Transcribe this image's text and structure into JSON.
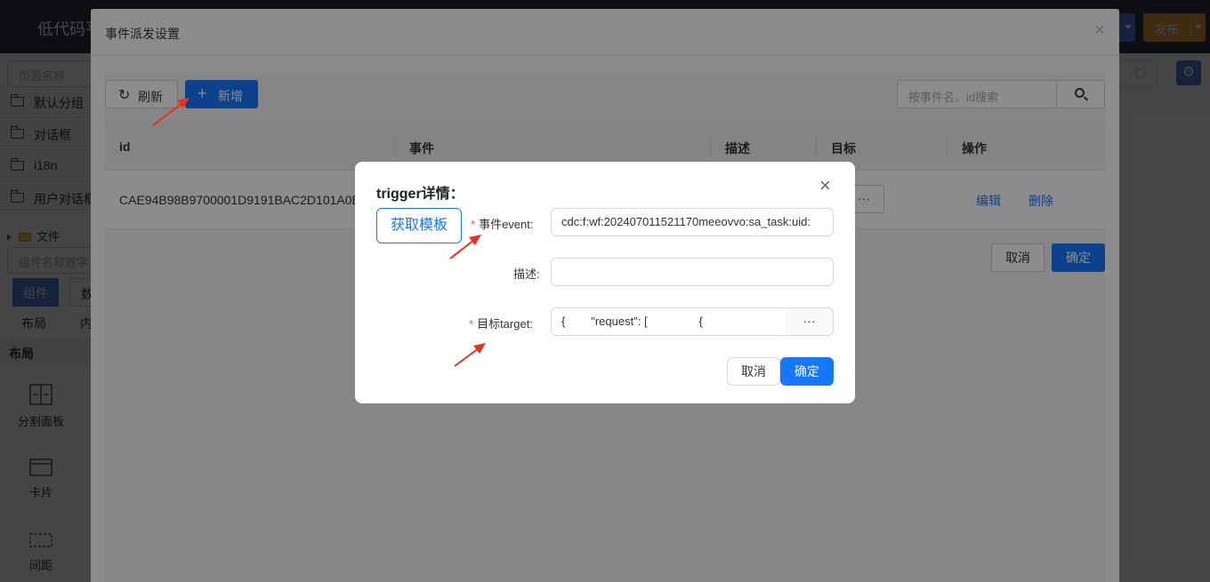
{
  "app": {
    "title": "低代码平",
    "publish_label": "发布"
  },
  "sidebar": {
    "search_placeholder": "页面名称",
    "groups": [
      "默认分组",
      "对话框",
      "i18n",
      "用户对话框"
    ],
    "file_label": "文件",
    "component_search_placeholder": "组件名称首字",
    "tabs": [
      "组件",
      "数"
    ],
    "sub_tabs": [
      "布局",
      "内"
    ],
    "section_title": "布局",
    "widgets": [
      "分割面板",
      "卡片",
      "间距"
    ]
  },
  "event_modal": {
    "title": "事件派发设置",
    "close": "×",
    "toolbar": {
      "refresh_label": "刷新",
      "add_label": "新增",
      "search_placeholder": "按事件名、id搜索"
    },
    "table": {
      "columns": [
        "id",
        "事件",
        "描述",
        "目标",
        "操作"
      ],
      "rows": [
        {
          "id": "CAE94B98B9700001D9191BAC2D101A0E",
          "target_btn": "···",
          "edit": "编辑",
          "delete": "删除"
        }
      ]
    },
    "cancel_label": "取消",
    "ok_label": "确定"
  },
  "trigger_dialog": {
    "title": "trigger详情：",
    "close": "×",
    "template_button": "获取模板",
    "fields": {
      "event": {
        "label": "事件event:",
        "value": "cdc:f:wf:202407011521170meeovvo:sa_task:uid:"
      },
      "desc": {
        "label": "描述:",
        "value": ""
      },
      "target": {
        "label": "目标target:",
        "value": "{        \"request\": [                {",
        "addon": "···"
      }
    },
    "cancel_label": "取消",
    "ok_label": "确定"
  },
  "colors": {
    "primary": "#1677ff",
    "danger": "#ff4d4f",
    "topbar": "#2c3440",
    "arrow": "#e8321e"
  }
}
